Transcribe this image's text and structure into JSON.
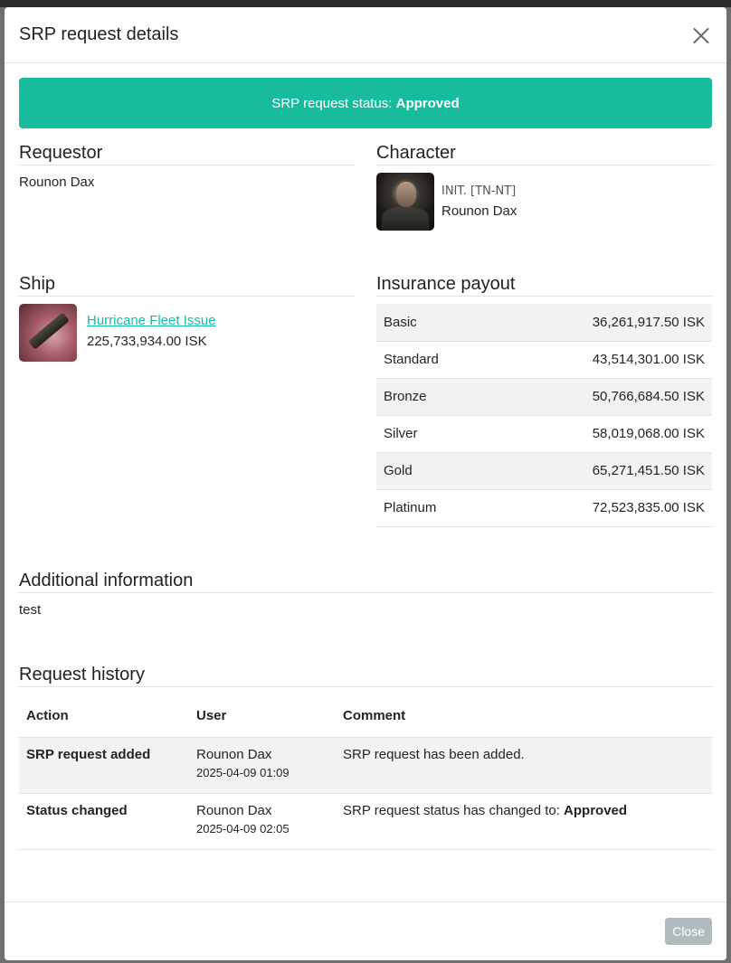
{
  "modal": {
    "title": "SRP request details",
    "status_prefix": "SRP request status:",
    "status_value": "Approved",
    "close_button": "Close"
  },
  "requestor": {
    "heading": "Requestor",
    "name": "Rounon Dax"
  },
  "character": {
    "heading": "Character",
    "corp": "INIT. [TN-NT]",
    "name": "Rounon Dax"
  },
  "ship": {
    "heading": "Ship",
    "name": "Hurricane Fleet Issue",
    "value": "225,733,934.00 ISK"
  },
  "insurance": {
    "heading": "Insurance payout",
    "rows": [
      {
        "level": "Basic",
        "amount": "36,261,917.50 ISK"
      },
      {
        "level": "Standard",
        "amount": "43,514,301.00 ISK"
      },
      {
        "level": "Bronze",
        "amount": "50,766,684.50 ISK"
      },
      {
        "level": "Silver",
        "amount": "58,019,068.00 ISK"
      },
      {
        "level": "Gold",
        "amount": "65,271,451.50 ISK"
      },
      {
        "level": "Platinum",
        "amount": "72,523,835.00 ISK"
      }
    ]
  },
  "additional": {
    "heading": "Additional information",
    "text": "test"
  },
  "history": {
    "heading": "Request history",
    "columns": [
      "Action",
      "User",
      "Comment"
    ],
    "rows": [
      {
        "action": "SRP request added",
        "user": "Rounon Dax",
        "date": "2025-04-09 01:09",
        "comment": "SRP request has been added.",
        "comment_bold": ""
      },
      {
        "action": "Status changed",
        "user": "Rounon Dax",
        "date": "2025-04-09 02:05",
        "comment": "SRP request status has changed to: ",
        "comment_bold": "Approved"
      }
    ]
  },
  "colors": {
    "accent": "#18bc9c",
    "close_button": "#95a5a6"
  }
}
